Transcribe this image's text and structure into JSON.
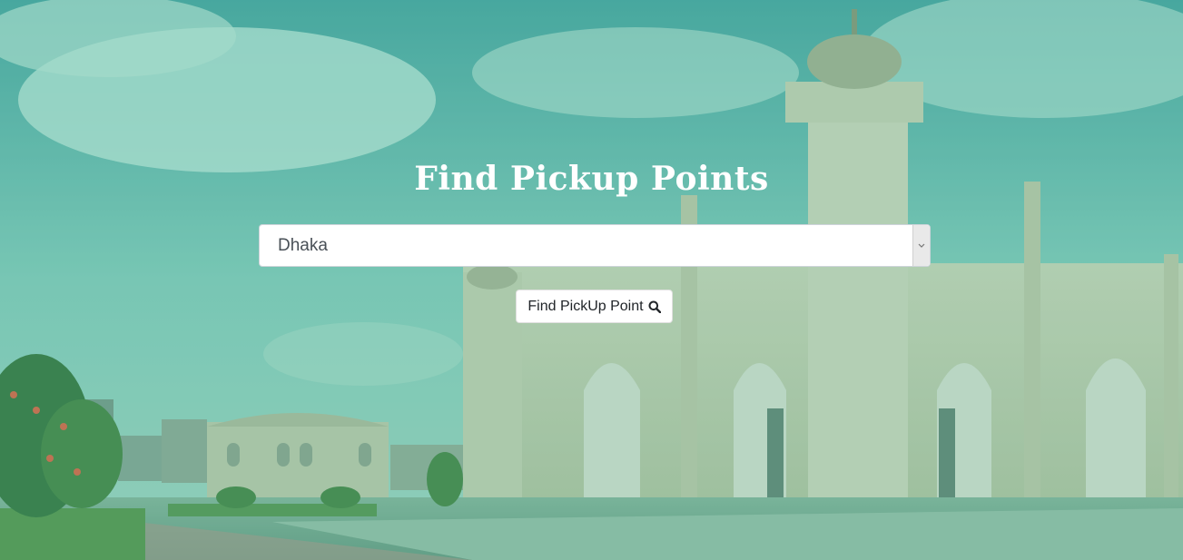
{
  "page": {
    "title": "Find Pickup Points"
  },
  "search": {
    "selected_city": "Dhaka",
    "button_label": "Find PickUp Point",
    "button_icon": "search-icon"
  },
  "colors": {
    "overlay": "#2aa082",
    "title_text": "#ffffff",
    "button_bg": "#ffffff"
  }
}
